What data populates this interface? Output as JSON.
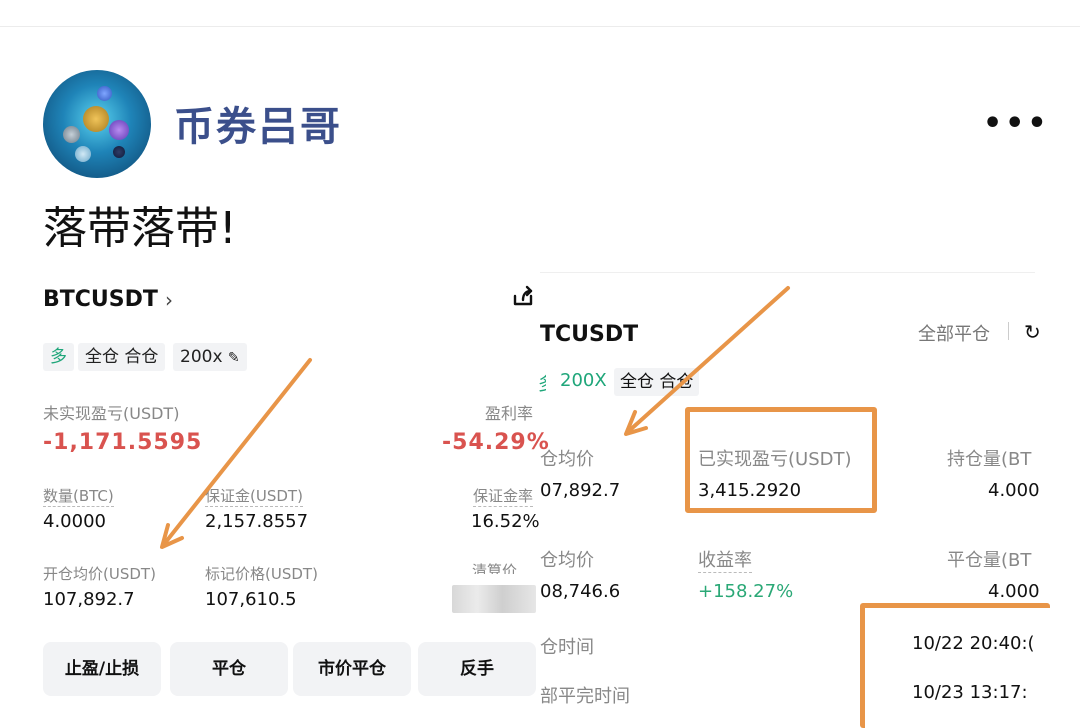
{
  "profile": {
    "username": "币券吕哥",
    "more_icon": "more-horizontal-icon",
    "post_text": "落带落带!"
  },
  "left_card": {
    "symbol": "BTCUSDT",
    "chevron": "›",
    "share_icon": "share-icon",
    "tags": {
      "direction": "多",
      "margin_mode": "全仓 合仓",
      "leverage": "200x",
      "edit_icon": "pencil-icon"
    },
    "unrealized_pnl_label": "未实现盈亏(USDT)",
    "unrealized_pnl_value": "-1,171.5595",
    "pnl_rate_label": "盈利率",
    "pnl_rate_value": "-54.29%",
    "qty_label": "数量(BTC)",
    "qty_value": "4.0000",
    "margin_label": "保证金(USDT)",
    "margin_value": "2,157.8557",
    "margin_rate_label": "保证金率",
    "margin_rate_value": "16.52%",
    "entry_label": "开仓均价(USDT)",
    "entry_value": "107,892.7",
    "mark_label": "标记价格(USDT)",
    "mark_value": "107,610.5",
    "liq_label_partial": "清算价",
    "buttons": [
      "止盈/止损",
      "平仓",
      "市价平仓",
      "反手"
    ]
  },
  "right_card": {
    "symbol": "TCUSDT",
    "close_all": "全部平仓",
    "direction_partial": "多",
    "leverage": "200X",
    "margin_mode": "全仓 合仓",
    "open_avg_label": "仓均价",
    "open_avg_value": "07,892.7",
    "realized_pnl_label": "已实现盈亏(USDT)",
    "realized_pnl_value": "3,415.2920",
    "holding_label": "持仓量(BT",
    "holding_value": "4.000",
    "close_avg_label": "仓均价",
    "close_avg_value": "08,746.6",
    "yield_label": "收益率",
    "yield_value": "+158.27%",
    "close_qty_label": "平仓量(BT",
    "close_qty_value": "4.000",
    "open_time_label": "仓时间",
    "open_time_value": "10/22 20:40:(",
    "close_time_label": "部平完时间",
    "close_time_value": "10/23 13:17:"
  },
  "annotation_color": "#e89548",
  "colors": {
    "username": "#3b4f8b",
    "loss": "#d9534f",
    "profit": "#2aa876"
  }
}
